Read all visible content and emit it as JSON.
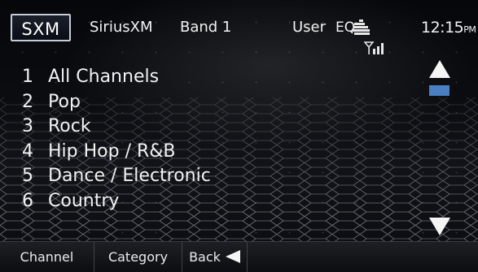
{
  "header": {
    "source_button": "SXM",
    "station": "SiriusXM",
    "band": "Band 1",
    "preset_bank": "User",
    "eq_label": "EQ",
    "clock_time": "12:15",
    "clock_ampm": "PM",
    "icons": [
      "eq-icon",
      "signal-strength-icon"
    ]
  },
  "channels": [
    {
      "number": "1",
      "name": "All Channels"
    },
    {
      "number": "2",
      "name": "Pop"
    },
    {
      "number": "3",
      "name": "Rock"
    },
    {
      "number": "4",
      "name": "Hip Hop / R&B"
    },
    {
      "number": "5",
      "name": "Dance / Electronic"
    },
    {
      "number": "6",
      "name": "Country"
    }
  ],
  "scrollbar": {
    "up_icon": "up-arrow-icon",
    "down_icon": "down-arrow-icon",
    "thumb_color": "#4a7fc4"
  },
  "soft_keys": {
    "channel": "Channel",
    "category": "Category",
    "back": "Back",
    "back_icon": "back-arrow-icon"
  }
}
